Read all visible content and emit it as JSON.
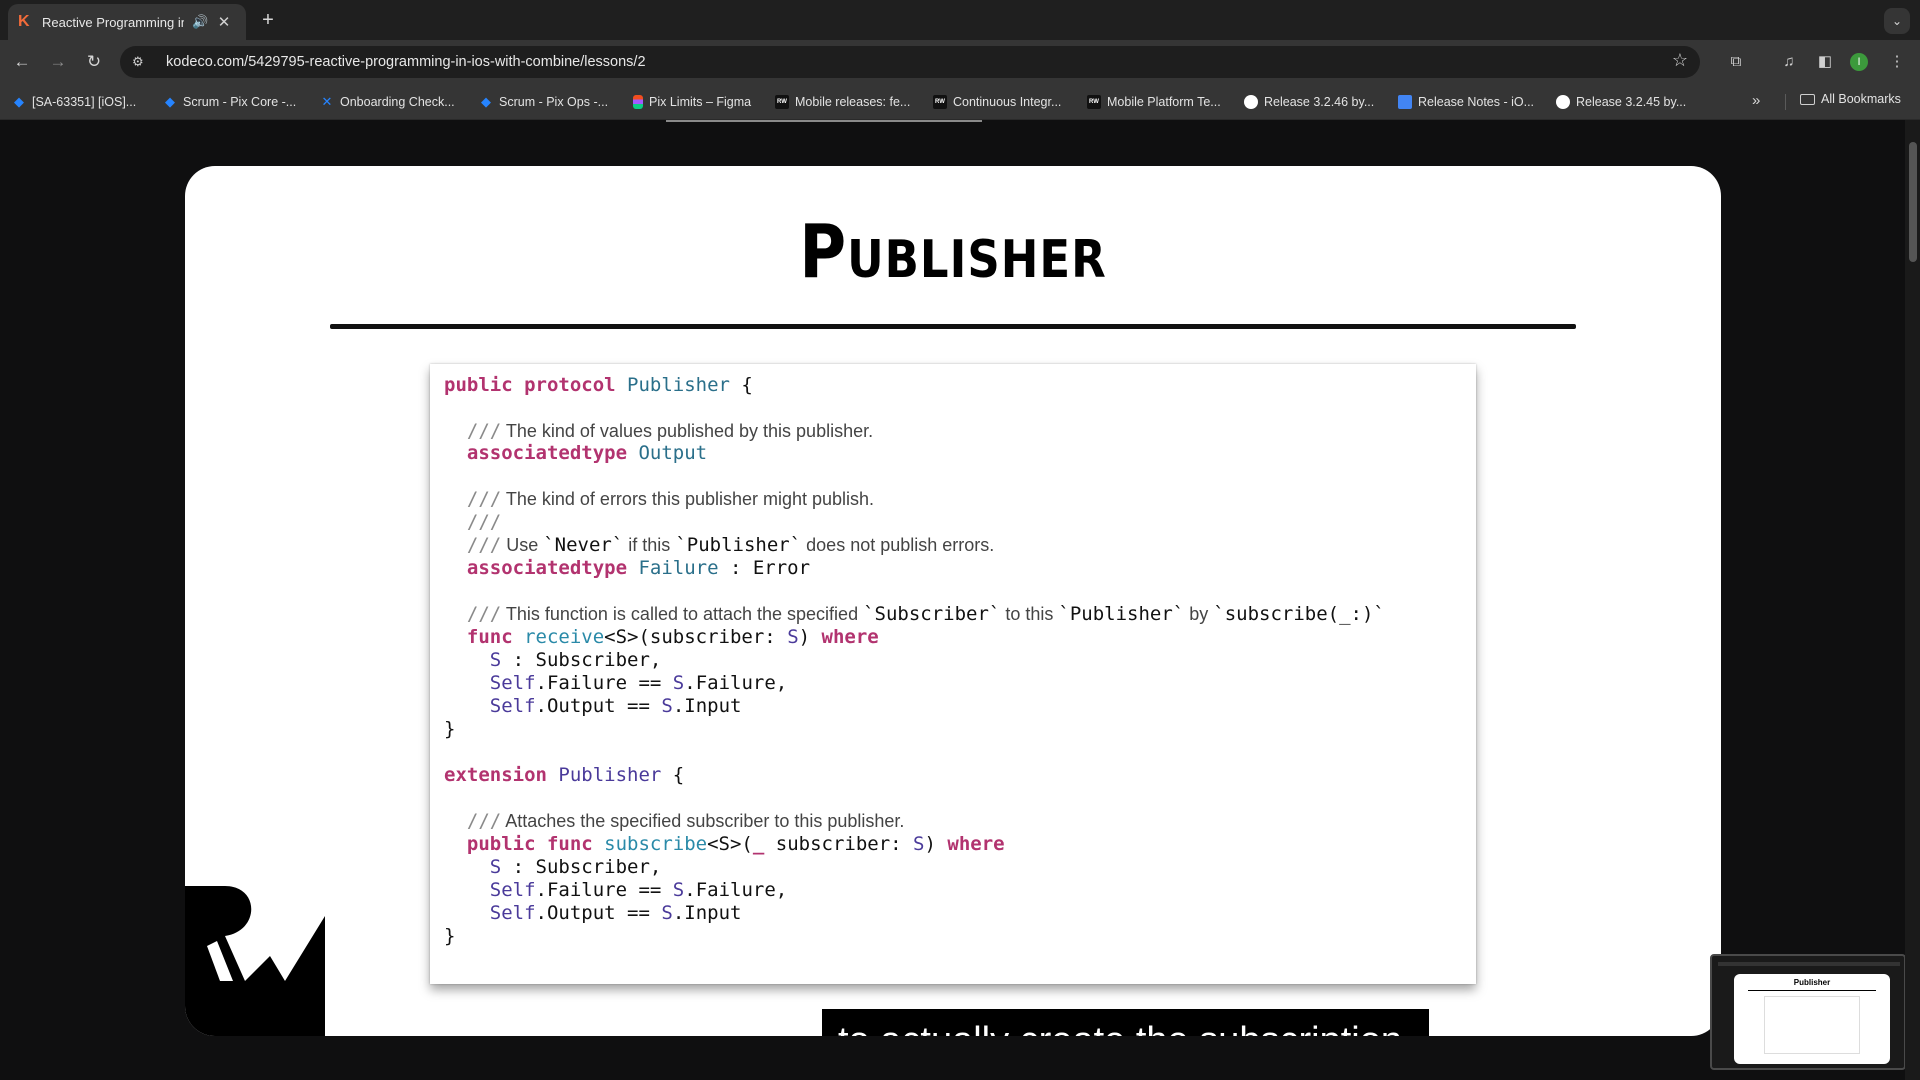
{
  "browser": {
    "tab": {
      "title": "Reactive Programming in",
      "favicon": "K",
      "audio_icon": "speaker-icon",
      "close_label": "✕"
    },
    "new_tab_label": "+",
    "url": "kodeco.com/5429795-reactive-programming-in-ios-with-combine/lessons/2",
    "profile_initial": "I",
    "bookmarks": [
      {
        "label": "[SA-63351] [iOS]...",
        "icon": "jira-icon"
      },
      {
        "label": "Scrum - Pix Core -...",
        "icon": "jira-icon"
      },
      {
        "label": "Onboarding Check...",
        "icon": "confluence-icon"
      },
      {
        "label": "Scrum - Pix Ops -...",
        "icon": "jira-icon"
      },
      {
        "label": "Pix Limits – Figma",
        "icon": "figma-icon"
      },
      {
        "label": "Mobile releases: fe...",
        "icon": "rw-icon"
      },
      {
        "label": "Continuous Integr...",
        "icon": "rw-icon"
      },
      {
        "label": "Mobile Platform Te...",
        "icon": "rw-icon"
      },
      {
        "label": "Release 3.2.46 by...",
        "icon": "github-icon"
      },
      {
        "label": "Release Notes - iO...",
        "icon": "docs-icon"
      },
      {
        "label": "Release 3.2.45 by...",
        "icon": "github-icon"
      }
    ],
    "more_bookmarks": "»",
    "all_bookmarks": "All Bookmarks"
  },
  "video": {
    "slide_title": "Publisher",
    "code": {
      "l1": {
        "kw": "public protocol",
        "ty": " Publisher",
        "rest": " {"
      },
      "c1": {
        "slashes": "  ///",
        "text": " The kind of values published by this publisher."
      },
      "l2": {
        "kw": "  associatedtype",
        "ty": " Output"
      },
      "c2": {
        "slashes": "  ///",
        "text": " The kind of errors this publisher might publish."
      },
      "c3": {
        "slashes": "  ///"
      },
      "c4": {
        "slashes": "  ///",
        "t1": " Use ",
        "m1": "`Never`",
        "t2": " if this ",
        "m2": "`Publisher`",
        "t3": " does not publish errors."
      },
      "l3": {
        "kw": "  associatedtype",
        "ty": " Failure",
        "rest": " : Error"
      },
      "c5": {
        "slashes": "  ///",
        "t1": " This function is called to attach the specified ",
        "m1": "`Subscriber`",
        "t2": " to this ",
        "m2": "`Publisher`",
        "t3": " by ",
        "m3": "`subscribe(_:)`"
      },
      "l4": {
        "kw": "  func",
        "fn": " receive",
        "rest": "<S>(subscriber: ",
        "sv": "S",
        "rest2": ") ",
        "kw2": "where"
      },
      "l5": {
        "sv": "    S",
        "rest": " : Subscriber,"
      },
      "l6": {
        "sv": "    Self",
        "rest": ".Failure == ",
        "sv2": "S",
        "rest2": ".Failure,"
      },
      "l7": {
        "sv": "    Self",
        "rest": ".Output == ",
        "sv2": "S",
        "rest2": ".Input"
      },
      "l8": "}",
      "l9": {
        "kw": "extension",
        "ty": " Publisher",
        "rest": " {"
      },
      "c6": {
        "slashes": "  ///",
        "text": " Attaches the specified subscriber to this publisher."
      },
      "l10": {
        "kw": "  public func",
        "fn": " subscribe",
        "rest": "<S>(",
        "kw3": "_",
        "rest1": " subscriber: ",
        "sv": "S",
        "rest2": ") ",
        "kw2": "where"
      },
      "l11": {
        "sv": "    S",
        "rest": " : Subscriber,"
      },
      "l12": {
        "sv": "    Self",
        "rest": ".Failure == ",
        "sv2": "S",
        "rest2": ".Failure,"
      },
      "l13": {
        "sv": "    Self",
        "rest": ".Output == ",
        "sv2": "S",
        "rest2": ".Input"
      },
      "l14": "}"
    },
    "caption": "to actually create the subscription.",
    "pip_title": "Publisher"
  },
  "colors": {
    "keyword": "#b2336f",
    "type": "#2a6f8a",
    "comment": "#8a8a8a",
    "page_bg": "#0f0f10",
    "chrome_bg": "#353535"
  }
}
